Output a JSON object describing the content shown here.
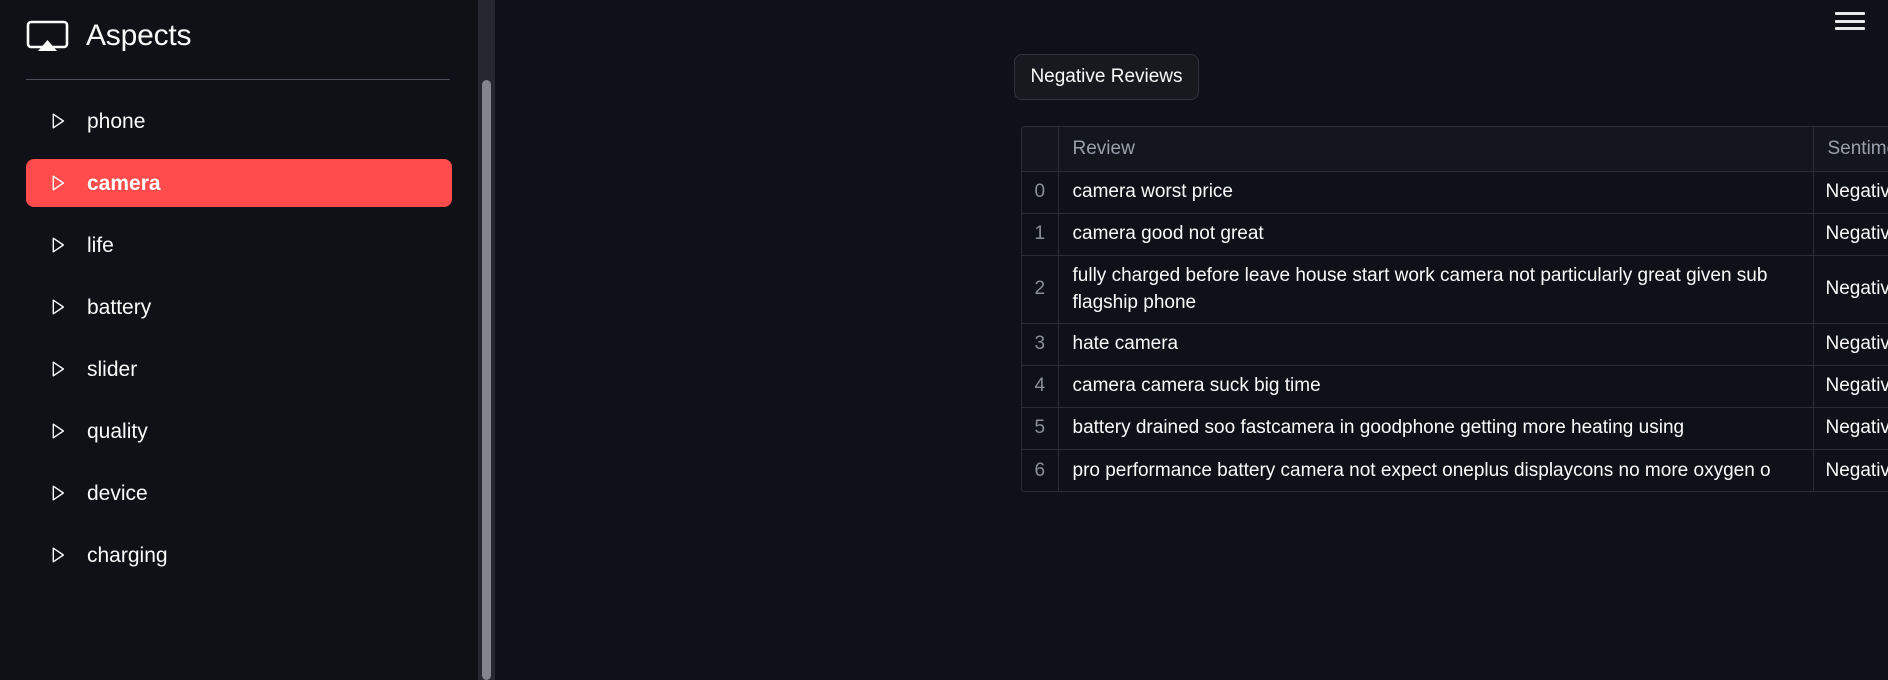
{
  "sidebar": {
    "title": "Aspects",
    "logo_icon": "airplay-icon",
    "items": [
      {
        "label": "phone",
        "icon": "triangle-right-icon",
        "selected": false
      },
      {
        "label": "camera",
        "icon": "triangle-right-icon",
        "selected": true
      },
      {
        "label": "life",
        "icon": "triangle-right-icon",
        "selected": false
      },
      {
        "label": "battery",
        "icon": "triangle-right-icon",
        "selected": false
      },
      {
        "label": "slider",
        "icon": "triangle-right-icon",
        "selected": false
      },
      {
        "label": "quality",
        "icon": "triangle-right-icon",
        "selected": false
      },
      {
        "label": "device",
        "icon": "triangle-right-icon",
        "selected": false
      },
      {
        "label": "charging",
        "icon": "triangle-right-icon",
        "selected": false
      }
    ],
    "selected_color": "#ff4b4b",
    "background": "#0f1117"
  },
  "main": {
    "menu_icon": "hamburger-menu-icon",
    "section_button": "Negative Reviews",
    "background": "#0e1117"
  },
  "table": {
    "columns": [
      "Review",
      "Sentiment"
    ],
    "rows": [
      {
        "index": "0",
        "review": "camera worst price",
        "sentiment": "Negative"
      },
      {
        "index": "1",
        "review": "camera good not great",
        "sentiment": "Negative"
      },
      {
        "index": "2",
        "review": "fully charged before leave house start work camera not particularly great given sub flagship phone",
        "sentiment": "Negative"
      },
      {
        "index": "3",
        "review": "hate camera",
        "sentiment": "Negative"
      },
      {
        "index": "4",
        "review": "camera camera suck big time",
        "sentiment": "Negative"
      },
      {
        "index": "5",
        "review": "battery drained soo fastcamera in goodphone getting more heating using",
        "sentiment": "Negative"
      },
      {
        "index": "6",
        "review": "pro performance battery camera not expect oneplus displaycons no more oxygen o",
        "sentiment": "Negative"
      }
    ]
  },
  "scrollbar": {
    "track_color": "#262730",
    "thumb_color": "#84858c"
  }
}
